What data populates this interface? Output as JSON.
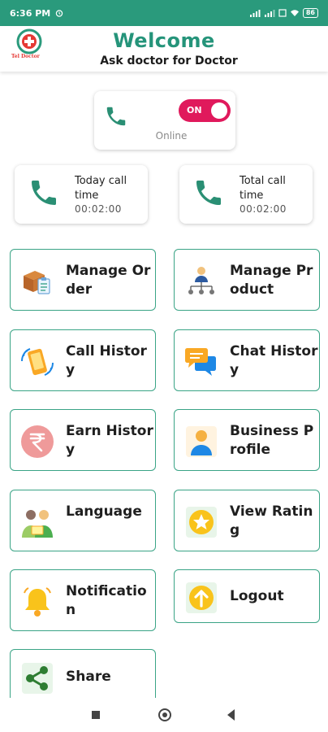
{
  "status_bar": {
    "time": "6:36 PM",
    "battery": "86"
  },
  "header": {
    "title": "Welcome",
    "subtitle": "Ask doctor for Doctor",
    "logo_text": "Tel Doctor"
  },
  "online": {
    "toggle_label": "ON",
    "status_text": "Online",
    "toggle_on": true
  },
  "call_time": {
    "today": {
      "label": "Today call time",
      "value": "00:02:00"
    },
    "total": {
      "label": "Total call time",
      "value": "00:02:00"
    }
  },
  "menu": [
    {
      "label": "Manage Order",
      "icon": "box-clipboard-icon"
    },
    {
      "label": "Manage Product",
      "icon": "org-chart-icon"
    },
    {
      "label": "Call History",
      "icon": "phone-ringing-icon"
    },
    {
      "label": "Chat History",
      "icon": "chat-bubbles-icon"
    },
    {
      "label": "Earn History",
      "icon": "rupee-icon"
    },
    {
      "label": "Business Profile",
      "icon": "profile-user-icon"
    },
    {
      "label": "Language",
      "icon": "people-language-icon"
    },
    {
      "label": "View Rating",
      "icon": "star-badge-icon"
    },
    {
      "label": "Notification",
      "icon": "bell-icon"
    },
    {
      "label": "Logout",
      "icon": "logout-arrow-icon"
    },
    {
      "label": "Share",
      "icon": "share-icon"
    }
  ],
  "colors": {
    "brand": "#25947a",
    "status_bar": "#2a9a7c",
    "toggle": "#e0195c",
    "tile_border": "#3aa486"
  }
}
